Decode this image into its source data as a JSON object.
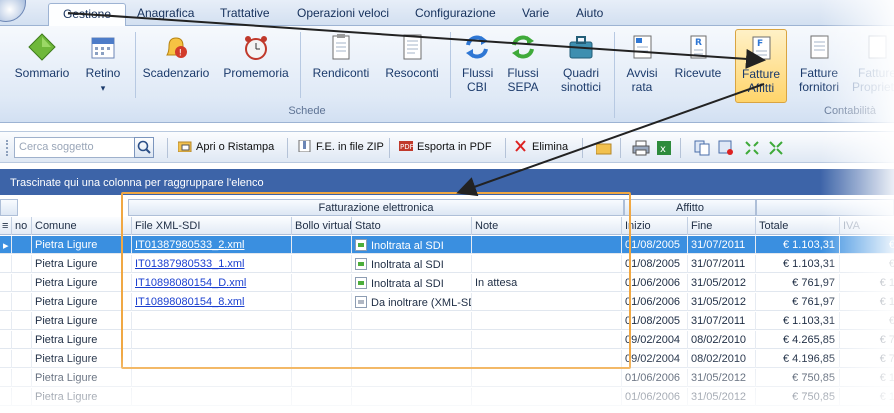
{
  "menu": {
    "tabs": [
      "Gestione",
      "Anagrafica",
      "Trattative",
      "Operazioni veloci",
      "Configurazione",
      "Varie",
      "Aiuto"
    ]
  },
  "ribbon": {
    "buttons": [
      {
        "label": "Sommario",
        "icon": "diamond-icon"
      },
      {
        "label": "Retino",
        "icon": "calendar-icon"
      },
      {
        "label": "Scadenzario",
        "icon": "alarm-bell-icon"
      },
      {
        "label": "Promemoria",
        "icon": "alarm-clock-icon"
      },
      {
        "label": "Rendiconti",
        "icon": "clipboard-icon"
      },
      {
        "label": "Resoconti",
        "icon": "document-icon"
      },
      {
        "label": "Flussi CBI",
        "icon": "refresh-blue-icon"
      },
      {
        "label": "Flussi SEPA",
        "icon": "refresh-green-icon"
      },
      {
        "label": "Quadri sinottici",
        "icon": "briefcase-icon"
      },
      {
        "label": "Avvisi rata",
        "icon": "notice-icon"
      },
      {
        "label": "Ricevute",
        "icon": "receipt-icon"
      },
      {
        "label": "Fatture Affitti",
        "icon": "invoice-rent-icon"
      },
      {
        "label": "Fatture fornitori",
        "icon": "invoice-suppliers-icon"
      },
      {
        "label": "Fatture Proprietari",
        "icon": "invoice-owners-icon"
      }
    ],
    "retino_dropdown": "▾",
    "groups": [
      "Schede",
      "Contabilità"
    ]
  },
  "toolbar": {
    "search_placeholder": "Cerca soggetto",
    "buttons": [
      "Apri o Ristampa",
      "F.E. in file ZIP",
      "Esporta in PDF",
      "Elimina"
    ]
  },
  "grid": {
    "group_hint": "Trascinate qui una colonna per raggruppare l'elenco",
    "bands": [
      "Fatturazione elettronica",
      "Affitto"
    ],
    "columns": [
      "no",
      "Comune",
      "File XML-SDI",
      "Bollo virtual",
      "Stato",
      "Note",
      "Inizio",
      "Fine",
      "Totale",
      "IVA"
    ],
    "rows": [
      {
        "comune": "Pietra Ligure",
        "file": "IT01387980533_2.xml",
        "stato": "Inoltrata al SDI",
        "note": "",
        "inizio": "01/08/2005",
        "fine": "31/07/2011",
        "totale": "€ 1.103,31",
        "iva": "€"
      },
      {
        "comune": "Pietra Ligure",
        "file": "IT01387980533_1.xml",
        "stato": "Inoltrata al SDI",
        "note": "",
        "inizio": "01/08/2005",
        "fine": "31/07/2011",
        "totale": "€ 1.103,31",
        "iva": "€"
      },
      {
        "comune": "Pietra Ligure",
        "file": "IT10898080154_D.xml",
        "stato": "Inoltrata al SDI",
        "note": "In attesa",
        "inizio": "01/06/2006",
        "fine": "31/05/2012",
        "totale": "€ 761,97",
        "iva": "€ 1"
      },
      {
        "comune": "Pietra Ligure",
        "file": "IT10898080154_8.xml",
        "stato": "Da inoltrare (XML-SDI",
        "note": "",
        "inizio": "01/06/2006",
        "fine": "31/05/2012",
        "totale": "€ 761,97",
        "iva": "€ 1"
      },
      {
        "comune": "Pietra Ligure",
        "file": "",
        "stato": "",
        "note": "",
        "inizio": "01/08/2005",
        "fine": "31/07/2011",
        "totale": "€ 1.103,31",
        "iva": "€"
      },
      {
        "comune": "Pietra Ligure",
        "file": "",
        "stato": "",
        "note": "",
        "inizio": "09/02/2004",
        "fine": "08/02/2010",
        "totale": "€ 4.265,85",
        "iva": "€ 7"
      },
      {
        "comune": "Pietra Ligure",
        "file": "",
        "stato": "",
        "note": "",
        "inizio": "09/02/2004",
        "fine": "08/02/2010",
        "totale": "€ 4.196,85",
        "iva": "€ 7"
      },
      {
        "comune": "Pietra Ligure",
        "file": "",
        "stato": "",
        "note": "",
        "inizio": "01/06/2006",
        "fine": "31/05/2012",
        "totale": "€ 750,85",
        "iva": "€ 1"
      },
      {
        "comune": "Pietra Ligure",
        "file": "",
        "stato": "",
        "note": "",
        "inizio": "01/06/2006",
        "fine": "31/05/2012",
        "totale": "€ 750,85",
        "iva": "€ 1"
      }
    ]
  },
  "colors": {
    "accent": "#3d64a8",
    "selected_row": "#3a8fe0",
    "highlight_box": "#f0a844"
  }
}
